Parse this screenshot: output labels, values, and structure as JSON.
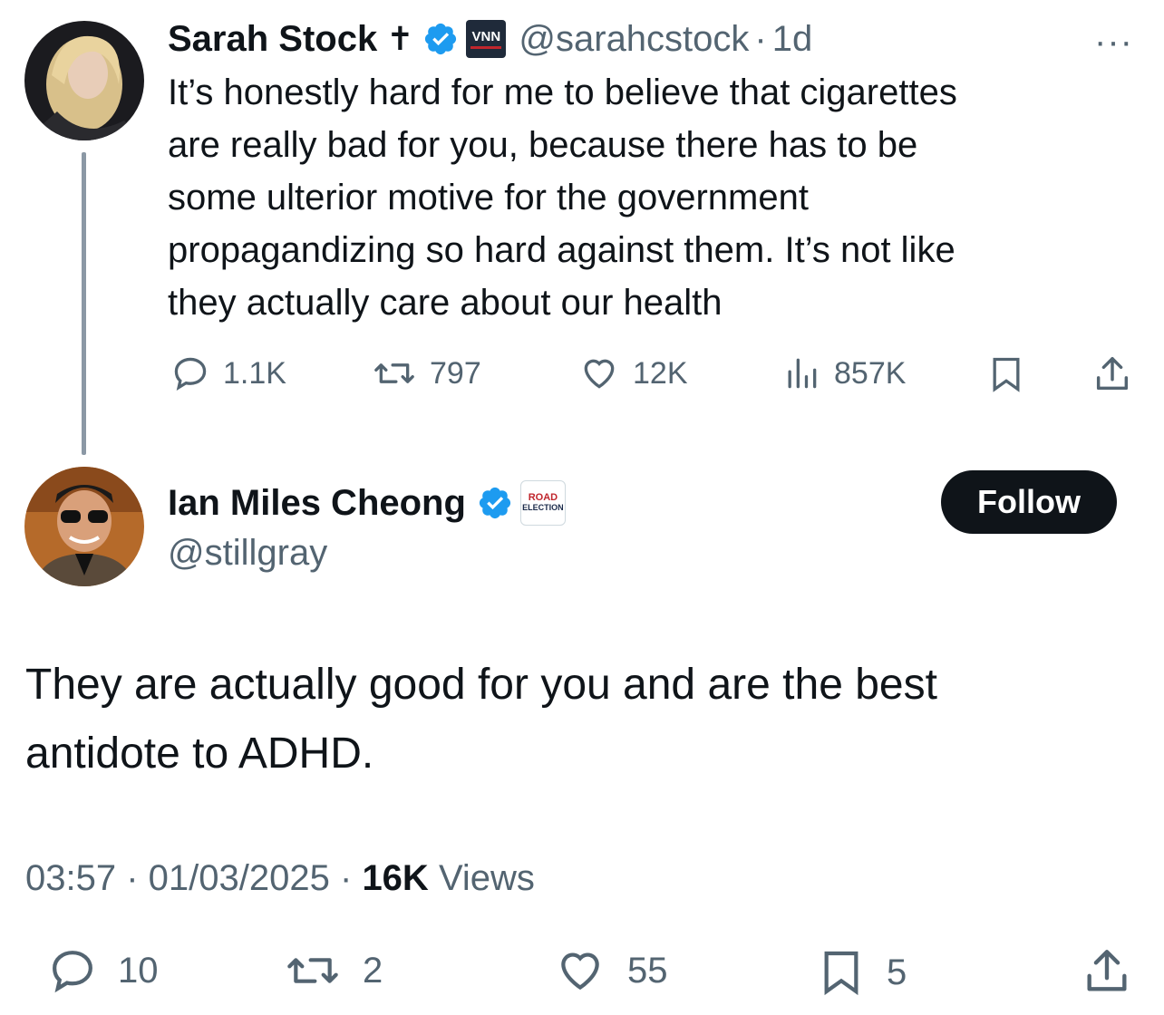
{
  "parent_tweet": {
    "author_name": "Sarah Stock",
    "author_emoji": "✝",
    "affiliate_badge": "VNN",
    "handle": "@sarahcstock",
    "separator": "·",
    "age": "1d",
    "more_icon": "···",
    "text_lines": [
      "It’s honestly hard for me to believe that cigarettes",
      "are really bad for you, because there has to be",
      "some ulterior motive for the government",
      "propagandizing so hard against them. It’s not like",
      "they actually care about our health"
    ],
    "stats": {
      "replies": "1.1K",
      "reposts": "797",
      "likes": "12K",
      "views": "857K"
    }
  },
  "main_tweet": {
    "author_name": "Ian Miles Cheong",
    "affiliate_badge_lines": [
      "ROAD",
      "ELECTION"
    ],
    "handle": "@stillgray",
    "follow_label": "Follow",
    "text_lines": [
      "They are actually good for you and are the best",
      "antidote to ADHD."
    ],
    "time": "03:57",
    "date": "01/03/2025",
    "views_count": "16K",
    "views_label": "Views",
    "stats": {
      "replies": "10",
      "reposts": "2",
      "likes": "55",
      "bookmarks": "5"
    }
  },
  "colors": {
    "text": "#0f1419",
    "secondary": "#536471",
    "verified": "#1d9bf0",
    "follow_bg": "#0f1419"
  }
}
